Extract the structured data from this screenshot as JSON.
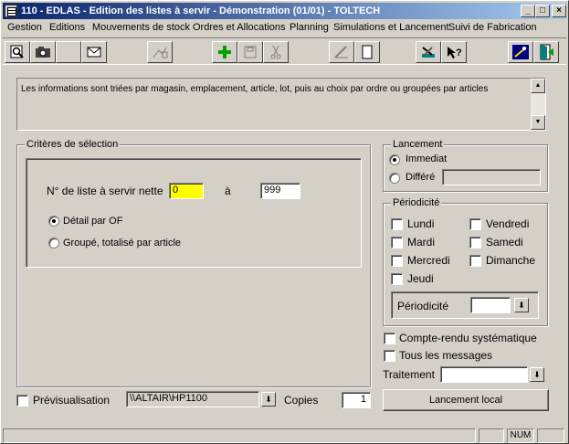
{
  "window": {
    "title": "110 - EDLAS - Edition des listes à servir - Démonstration (01/01) - TOLTECH",
    "minimize": "_",
    "maximize": "□",
    "close": "×"
  },
  "menu": [
    {
      "label": "Gestion"
    },
    {
      "label": "Editions"
    },
    {
      "label": "Mouvements de stock"
    },
    {
      "label": "Ordres et Allocations"
    },
    {
      "label": "Planning"
    },
    {
      "label": "Simulations et Lancement"
    },
    {
      "label": "Suivi de Fabrication"
    }
  ],
  "info": {
    "text": "Les informations sont triées par magasin, emplacement, article, lot, puis au choix par ordre ou groupées par articles"
  },
  "criteria": {
    "group_label": "Critères de sélection",
    "list_label": "N° de liste à servir nette",
    "from_value": "0",
    "to_label": "à",
    "to_value": "999",
    "detail_label": "Détail par OF",
    "grouped_label": "Groupé, totalisé par article"
  },
  "launch": {
    "group_label": "Lancement",
    "immediate_label": "Immediat",
    "deferred_label": "Différé",
    "deferred_value": ""
  },
  "periodicity": {
    "group_label": "Périodicité",
    "days": {
      "monday": "Lundi",
      "tuesday": "Mardi",
      "wednesday": "Mercredi",
      "thursday": "Jeudi",
      "friday": "Vendredi",
      "saturday": "Samedi",
      "sunday": "Dimanche"
    },
    "periodicity_label": "Périodicité",
    "periodicity_value": ""
  },
  "options": {
    "report_label": "Compte-rendu systématique",
    "all_messages_label": "Tous les messages",
    "processing_label": "Traitement",
    "processing_value": ""
  },
  "print": {
    "preview_label": "Prévisualisation",
    "printer_value": "\\\\ALTAIR\\HP1100",
    "copies_label": "Copies",
    "copies_value": "1",
    "launch_button": "Lancement local"
  },
  "status": {
    "num": "NUM"
  },
  "colors": {
    "highlight_field": "#ffff00",
    "titlebar_start": "#0a246a",
    "titlebar_end": "#a6caf0"
  }
}
